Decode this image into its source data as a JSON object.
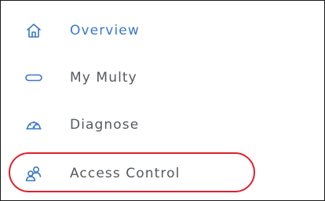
{
  "sidebar": {
    "items": [
      {
        "label": "Overview",
        "icon": "home-icon",
        "active": true
      },
      {
        "label": "My Multy",
        "icon": "device-icon",
        "active": false
      },
      {
        "label": "Diagnose",
        "icon": "speedometer-icon",
        "active": false
      },
      {
        "label": "Access Control",
        "icon": "users-icon",
        "active": false,
        "highlighted": true
      }
    ]
  },
  "colors": {
    "active_text": "#3c78c8",
    "inactive_text": "#555a5f",
    "icon_blue": "#3c78c8",
    "highlight_ring": "#e0202c",
    "frame_border": "#1a1a1a"
  }
}
